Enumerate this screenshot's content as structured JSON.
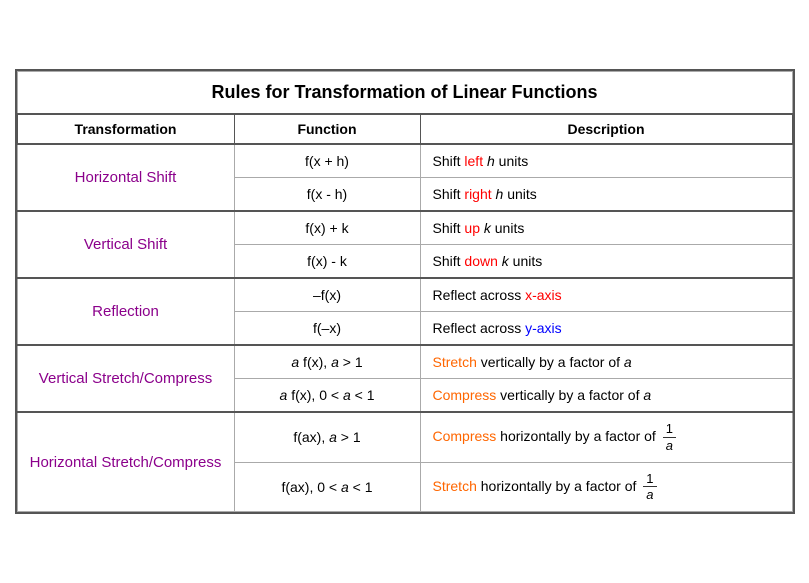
{
  "title": "Rules for Transformation of Linear Functions",
  "headers": {
    "transformation": "Transformation",
    "function": "Function",
    "description": "Description"
  },
  "rows": [
    {
      "group": "Horizontal Shift",
      "entries": [
        {
          "function": "f(x + h)",
          "description_parts": [
            "Shift ",
            "left",
            " h units"
          ],
          "highlight": "left",
          "highlight_color": "red"
        },
        {
          "function": "f(x  - h)",
          "description_parts": [
            "Shift ",
            "right",
            " h units"
          ],
          "highlight": "right",
          "highlight_color": "red"
        }
      ]
    },
    {
      "group": "Vertical Shift",
      "entries": [
        {
          "function": "f(x) + k",
          "description_parts": [
            "Shift ",
            "up",
            " k units"
          ],
          "highlight": "up",
          "highlight_color": "red"
        },
        {
          "function": "f(x) - k",
          "description_parts": [
            "Shift ",
            "down",
            " k units"
          ],
          "highlight": "down",
          "highlight_color": "red"
        }
      ]
    },
    {
      "group": "Reflection",
      "entries": [
        {
          "function": "–f(x)",
          "description_parts": [
            "Reflect across ",
            "x-axis",
            ""
          ],
          "highlight": "x-axis",
          "highlight_color": "red"
        },
        {
          "function": "f(–x)",
          "description_parts": [
            "Reflect across ",
            "y-axis",
            ""
          ],
          "highlight": "y-axis",
          "highlight_color": "blue"
        }
      ]
    },
    {
      "group": "Vertical Stretch/Compress",
      "entries": [
        {
          "function": "a f(x), a > 1",
          "description_parts": [
            "Stretch",
            " vertically by a factor of ",
            "a"
          ],
          "highlight": "Stretch",
          "highlight_color": "orange"
        },
        {
          "function": "a f(x), 0 < a < 1",
          "description_parts": [
            "Compress",
            " vertically by a factor of ",
            "a"
          ],
          "highlight": "Compress",
          "highlight_color": "orange"
        }
      ]
    },
    {
      "group": "Horizontal Stretch/Compress",
      "entries": [
        {
          "function": "f(ax), a > 1",
          "description_type": "fraction",
          "description_parts": [
            "Compress",
            " horizontally by a factor of "
          ],
          "highlight": "Compress",
          "highlight_color": "orange",
          "fraction": {
            "num": "1",
            "den": "a"
          }
        },
        {
          "function": "f(ax), 0 < a < 1",
          "description_type": "fraction",
          "description_parts": [
            "Stretch",
            " horizontally by a factor of "
          ],
          "highlight": "Stretch",
          "highlight_color": "orange",
          "fraction": {
            "num": "1",
            "den": "a"
          }
        }
      ]
    }
  ]
}
